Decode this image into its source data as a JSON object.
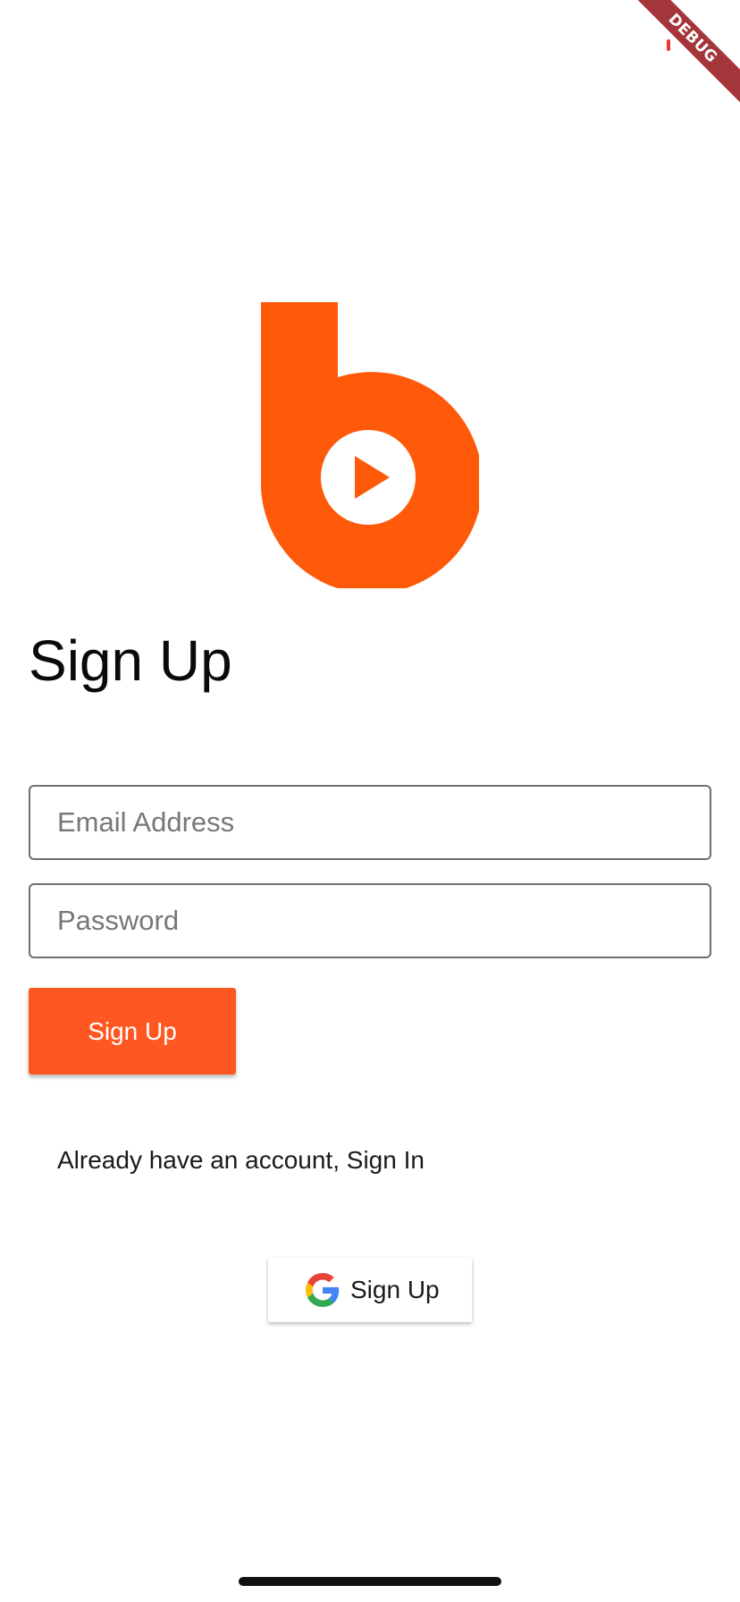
{
  "debug_banner": {
    "label": "DEBUG"
  },
  "logo": {
    "brand_color": "#ff5a0a",
    "icon": "play-b-logo-icon"
  },
  "page": {
    "title": "Sign Up"
  },
  "form": {
    "email": {
      "placeholder": "Email Address",
      "value": ""
    },
    "password": {
      "placeholder": "Password",
      "value": ""
    },
    "submit_label": "Sign Up",
    "submit_color": "#ff5722"
  },
  "signin_prompt": "Already have an account, Sign In",
  "google_signup": {
    "label": "Sign Up",
    "icon": "google-logo-icon"
  }
}
